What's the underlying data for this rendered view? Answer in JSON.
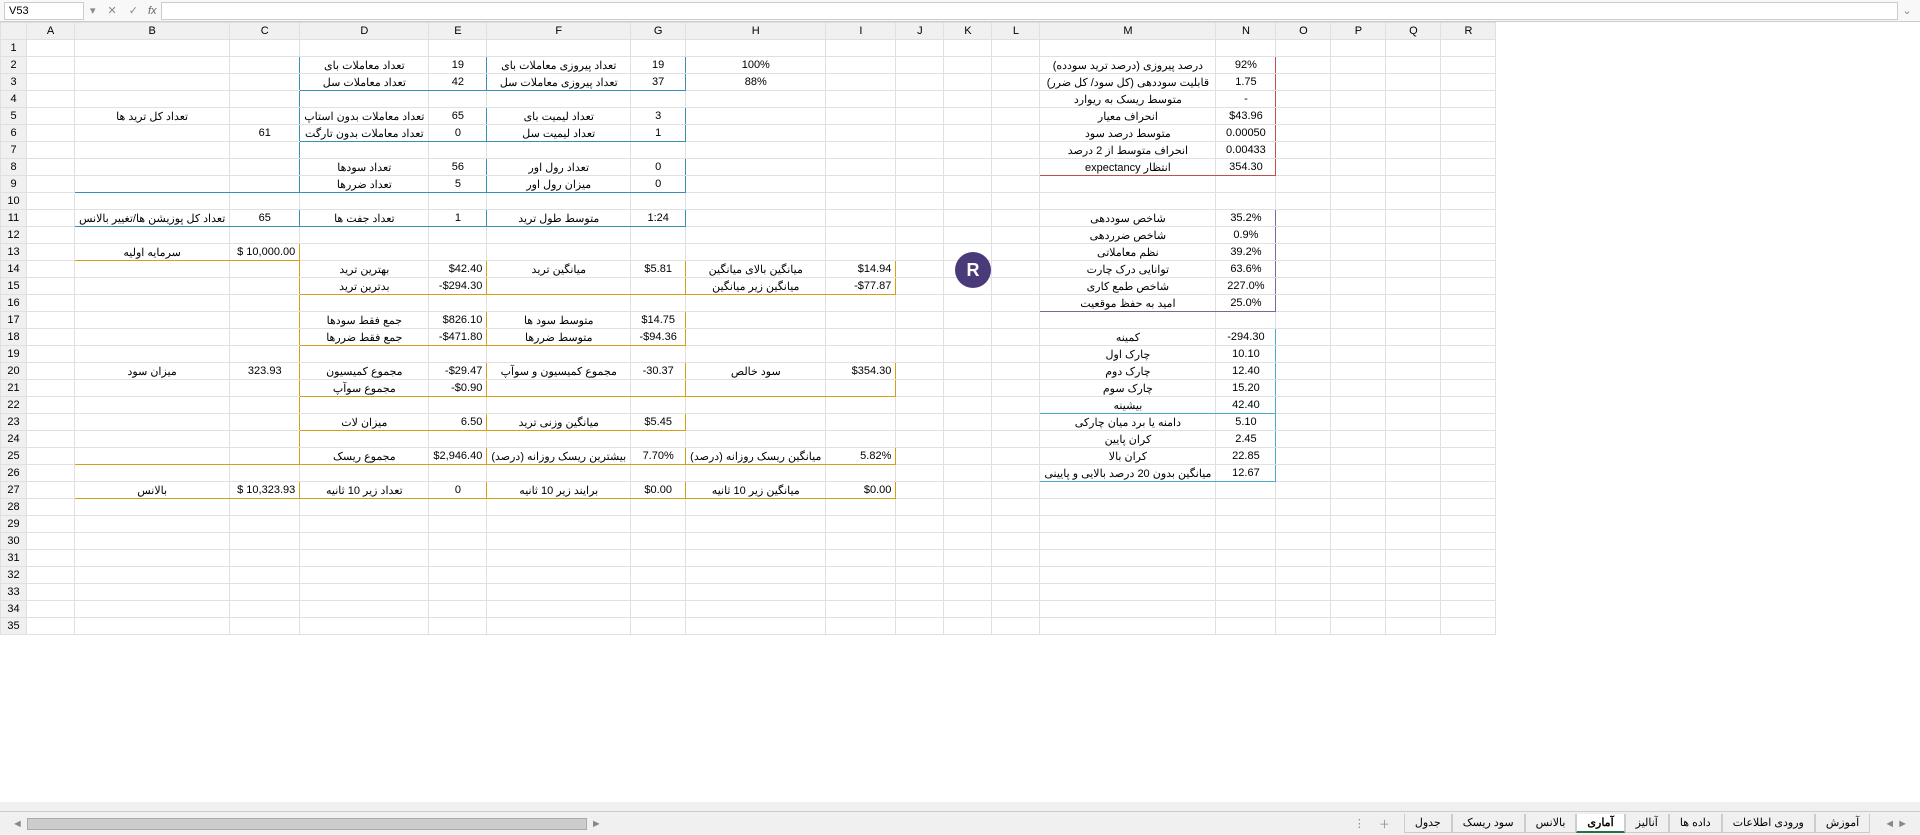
{
  "nameBox": "V53",
  "columns": [
    "A",
    "B",
    "C",
    "D",
    "E",
    "F",
    "G",
    "H",
    "I",
    "J",
    "K",
    "L",
    "M",
    "N",
    "O",
    "P",
    "Q",
    "R"
  ],
  "colWidths": {
    "A": 48,
    "B": 125,
    "C": 70,
    "D": 100,
    "E": 55,
    "F": 110,
    "G": 55,
    "H": 120,
    "I": 70,
    "J": 48,
    "K": 48,
    "L": 48,
    "M": 165,
    "N": 60,
    "O": 55,
    "P": 55,
    "Q": 55,
    "R": 55
  },
  "blueBox1": {
    "B": "تعداد کل ترید ها",
    "C": "61",
    "r2": {
      "D": "تعداد معاملات بای",
      "E": "19",
      "F": "تعداد پیروزی معاملات بای",
      "G": "19",
      "H": "100%"
    },
    "r3": {
      "D": "تعداد معاملات سل",
      "E": "42",
      "F": "تعداد پیروزی معاملات سل",
      "G": "37",
      "H": "88%"
    },
    "r5": {
      "D": "تعداد معاملات بدون استاپ",
      "E": "65",
      "F": "تعداد لیمیت بای",
      "G": "3"
    },
    "r6": {
      "D": "تعداد معاملات بدون تارگت",
      "E": "0",
      "F": "تعداد لیمیت سل",
      "G": "1"
    },
    "r8": {
      "D": "تعداد سودها",
      "E": "56",
      "F": "تعداد رول اور",
      "G": "0"
    },
    "r9": {
      "D": "تعداد ضررها",
      "E": "5",
      "F": "میزان رول اور",
      "G": "0"
    }
  },
  "blueBox2": {
    "B": "تعداد کل پوزیشن ها/تغییر بالانس",
    "C": "65",
    "D": "تعداد جفت ها",
    "E": "1",
    "F": "متوسط طول ترید",
    "G": "1:24"
  },
  "yel1": {
    "B": "سرمایه اولیه",
    "C": "$   10,000.00"
  },
  "yelMain": {
    "B": "میزان سود",
    "C": "323.93",
    "r14": {
      "D": "بهترین ترید",
      "E": "$42.40",
      "F": "میانگین ترید",
      "G": "$5.81",
      "H": "میانگین بالای میانگین",
      "I": "$14.94"
    },
    "r15": {
      "D": "بدترین ترید",
      "E": "-$294.30",
      "H": "میانگین زیر میانگین",
      "I": "-$77.87"
    },
    "r17": {
      "D": "جمع فقط سودها",
      "E": "$826.10",
      "F": "متوسط سود ها",
      "G": "$14.75"
    },
    "r18": {
      "D": "جمع فقط ضررها",
      "E": "-$471.80",
      "F": "متوسط ضررها",
      "G": "-$94.36"
    },
    "r20": {
      "D": "مجموع کمیسیون",
      "E": "-$29.47",
      "F": "مجموع کمیسیون و سوآپ",
      "G": "-30.37",
      "H": "سود خالص",
      "I": "$354.30"
    },
    "r21": {
      "D": "مجموع سوآپ",
      "E": "-$0.90"
    },
    "r23": {
      "D": "میزان لات",
      "E": "6.50",
      "F": "میانگین وزنی ترید",
      "G": "$5.45"
    },
    "r25": {
      "D": "مجموع ریسک",
      "E": "$2,946.40",
      "F": "بیشترین ریسک روزانه (درصد)",
      "G": "7.70%",
      "H": "میانگین ریسک روزانه (درصد)",
      "I": "5.82%"
    }
  },
  "yel27": {
    "B": "بالانس",
    "C": "$   10,323.93",
    "D": "تعداد زیر 10 ثانیه",
    "E": "0",
    "F": "برایند زیر 10 ثانیه",
    "G": "$0.00",
    "H": "میانگین زیر 10 ثانیه",
    "I": "$0.00"
  },
  "redBox": [
    {
      "M": "درصد پیروزی (درصد ترید سودده)",
      "N": "92%"
    },
    {
      "M": "قابلیت سوددهی (کل سود/ کل ضرر)",
      "N": "1.75"
    },
    {
      "M": "متوسط ریسک به ریوارد",
      "N": "-"
    },
    {
      "M": "انحراف معیار",
      "N": "$43.96"
    },
    {
      "M": "متوسط درصد سود",
      "N": "0.00050"
    },
    {
      "M": "انحراف متوسط از 2 درصد",
      "N": "0.00433"
    },
    {
      "M": "انتظار expectancy",
      "N": "354.30"
    }
  ],
  "purBox": [
    {
      "M": "شاخص سوددهی",
      "N": "35.2%"
    },
    {
      "M": "شاخص ضرردهی",
      "N": "0.9%"
    },
    {
      "M": "نظم معاملاتی",
      "N": "39.2%"
    },
    {
      "M": "توانایی درک چارت",
      "N": "63.6%"
    },
    {
      "M": "شاخص طمع کاری",
      "N": "227.0%"
    },
    {
      "M": "امید به حفظ موقعیت",
      "N": "25.0%"
    }
  ],
  "grnBox1": [
    {
      "M": "کمینه",
      "N": "-294.30"
    },
    {
      "M": "چارک اول",
      "N": "10.10"
    },
    {
      "M": "چارک دوم",
      "N": "12.40"
    },
    {
      "M": "چارک سوم",
      "N": "15.20"
    },
    {
      "M": "بیشینه",
      "N": "42.40"
    }
  ],
  "grnBox2": [
    {
      "M": "دامنه یا برد میان چارکی",
      "N": "5.10"
    },
    {
      "M": "کران پایین",
      "N": "2.45"
    },
    {
      "M": "کران بالا",
      "N": "22.85"
    },
    {
      "M": "میانگین بدون 20 درصد بالایی و پایینی",
      "N": "12.67"
    }
  ],
  "tabs": [
    "آموزش",
    "ورودی اطلاعات",
    "داده ها",
    "آنالیز",
    "آماری",
    "بالانس",
    "سود ریسک",
    "جدول"
  ],
  "activeTab": "آماری"
}
